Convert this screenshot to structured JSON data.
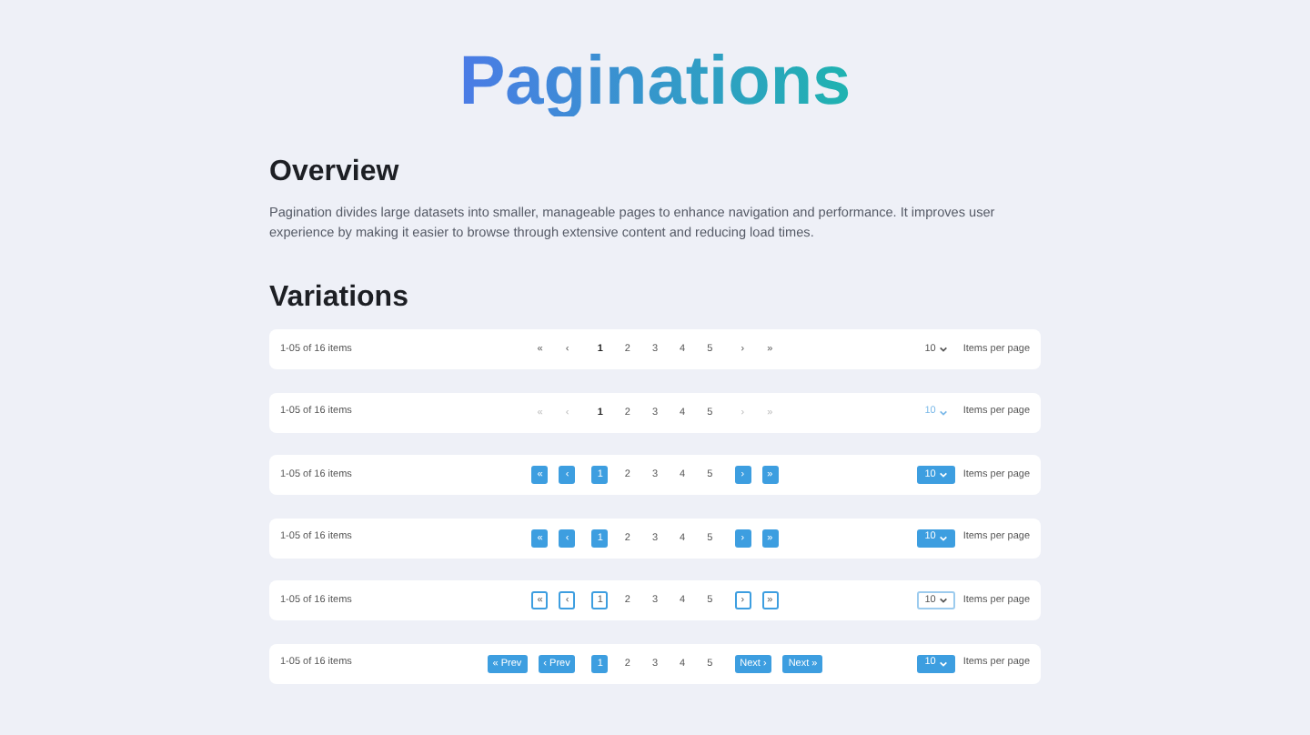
{
  "title": "Paginations",
  "overview": {
    "heading": "Overview",
    "text": "Pagination divides large datasets into smaller, manageable pages to enhance navigation and performance. It improves user experience by making it easier to browse through extensive content and reducing load times."
  },
  "variations": {
    "heading": "Variations",
    "rows": [
      {
        "kind": "plain",
        "summary": "1-05 of 16 items",
        "first": "«",
        "prev": "‹",
        "pages": [
          {
            "label": "1",
            "selected": true
          },
          {
            "label": "2",
            "selected": false
          },
          {
            "label": "3",
            "selected": false
          },
          {
            "label": "4",
            "selected": false
          },
          {
            "label": "5",
            "selected": false
          }
        ],
        "next": "›",
        "last": "»",
        "per_page": "10",
        "per_page_label": "Items per page"
      },
      {
        "kind": "muted",
        "summary": "1-05 of 16 items",
        "first": "«",
        "prev": "‹",
        "pages": [
          {
            "label": "1",
            "selected": true
          },
          {
            "label": "2",
            "selected": false
          },
          {
            "label": "3",
            "selected": false
          },
          {
            "label": "4",
            "selected": false
          },
          {
            "label": "5",
            "selected": false
          }
        ],
        "next": "›",
        "last": "»",
        "per_page": "10",
        "per_page_label": "Items per page"
      },
      {
        "kind": "filled",
        "summary": "1-05 of 16 items",
        "first": "«",
        "prev": "‹",
        "pages": [
          {
            "label": "1",
            "selected": true
          },
          {
            "label": "2",
            "selected": false
          },
          {
            "label": "3",
            "selected": false
          },
          {
            "label": "4",
            "selected": false
          },
          {
            "label": "5",
            "selected": false
          }
        ],
        "next": "›",
        "last": "»",
        "per_page": "10",
        "per_page_label": "Items per page"
      },
      {
        "kind": "filled",
        "summary": "1-05 of 16 items",
        "first": "«",
        "prev": "‹",
        "pages": [
          {
            "label": "1",
            "selected": true
          },
          {
            "label": "2",
            "selected": false
          },
          {
            "label": "3",
            "selected": false
          },
          {
            "label": "4",
            "selected": false
          },
          {
            "label": "5",
            "selected": false
          }
        ],
        "next": "›",
        "last": "»",
        "per_page": "10",
        "per_page_label": "Items per page"
      },
      {
        "kind": "outline",
        "summary": "1-05 of 16 items",
        "first": "«",
        "prev": "‹",
        "pages": [
          {
            "label": "1",
            "selected": true
          },
          {
            "label": "2",
            "selected": false
          },
          {
            "label": "3",
            "selected": false
          },
          {
            "label": "4",
            "selected": false
          },
          {
            "label": "5",
            "selected": false
          }
        ],
        "next": "›",
        "last": "»",
        "per_page": "10",
        "per_page_label": "Items per page"
      },
      {
        "kind": "filled",
        "summary": "1-05 of 16 items",
        "first": "« Prev",
        "prev": "‹ Prev",
        "pages": [
          {
            "label": "1",
            "selected": true
          },
          {
            "label": "2",
            "selected": false
          },
          {
            "label": "3",
            "selected": false
          },
          {
            "label": "4",
            "selected": false
          },
          {
            "label": "5",
            "selected": false
          }
        ],
        "next": "Next ›",
        "last": "Next »",
        "per_page": "10",
        "per_page_label": "Items per page"
      }
    ]
  }
}
